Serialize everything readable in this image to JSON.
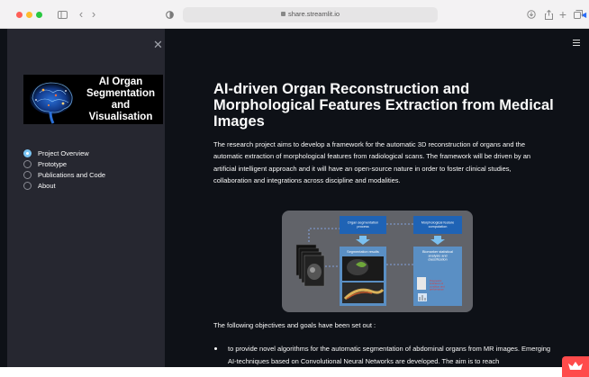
{
  "browser": {
    "url": "share.streamlit.io",
    "colors": {
      "close": "#fe5f57",
      "minimize": "#febc2e",
      "maximize": "#28c840"
    }
  },
  "sidebar": {
    "logo_lines": [
      "AI Organ",
      "Segmentation",
      "and",
      "Visualisation"
    ],
    "nav_items": [
      {
        "label": "Project Overview",
        "selected": true
      },
      {
        "label": "Prototype",
        "selected": false
      },
      {
        "label": "Publications and Code",
        "selected": false
      },
      {
        "label": "About",
        "selected": false
      }
    ],
    "accent_color": "#7ac4f3"
  },
  "main": {
    "title": "AI-driven Organ Reconstruction and Morphological Features Extraction from Medical Images",
    "intro": "The research project aims to develop a framework for the automatic 3D reconstruction of organs and the automatic extraction of morphological features from radiological scans. The framework will be driven by an artificial intelligent approach and it will have an open-source nature in order to foster clinical studies, collaboration and integrations across discipline and modalities.",
    "figure": {
      "boxes": [
        "Organ segmentation process",
        "Segmentation results",
        "Morphological feature computation",
        "Biomarker statistical analysis and classification"
      ],
      "note": "Prognostic indicators of condition and performance"
    },
    "objectives_intro": "The following objectives and goals have been set out :",
    "bullets": [
      "to provide novel algorithms for the automatic segmentation of abdominal organs from MR images. Emerging AI-techniques based on Convolutional Neural Networks are developed. The aim is to reach"
    ]
  },
  "theme": {
    "background": "#0e1117",
    "sidebar": "#262730",
    "brand": "#ff4b4b"
  }
}
